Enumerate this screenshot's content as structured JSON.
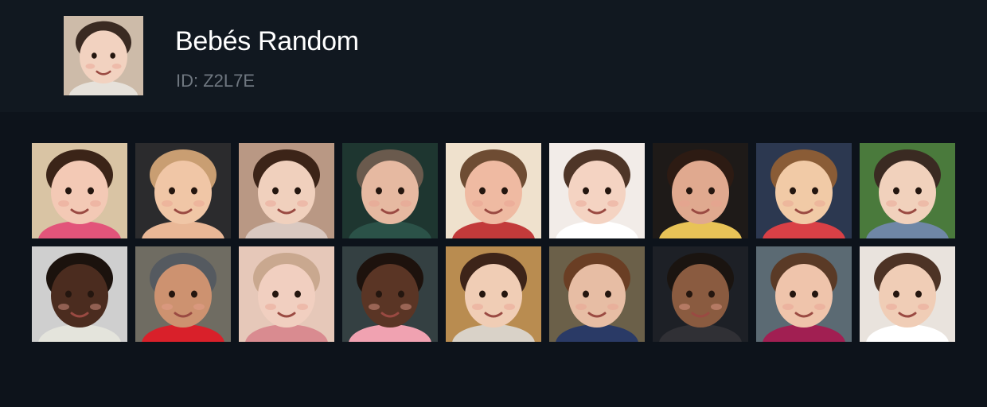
{
  "channel": {
    "name": "Bebés Random",
    "id_text": "ID: Z2L7E",
    "avatar_icon": "baby-photo",
    "avatar_colors": {
      "bg": "#cdbba9",
      "skin": "#f2d2c0",
      "hair": "#3a2a22",
      "accent": "#e6e1da"
    }
  },
  "photos": [
    {
      "icon": "baby-photo",
      "bg": "#d9c4a4",
      "skin": "#f3c9b5",
      "hair": "#3b2418",
      "accent": "#e2547a"
    },
    {
      "icon": "baby-photo",
      "bg": "#2b2b2d",
      "skin": "#f0c6a6",
      "hair": "#c99e72",
      "accent": "#e9b796"
    },
    {
      "icon": "baby-photo",
      "bg": "#b99884",
      "skin": "#f0d0bd",
      "hair": "#3c2418",
      "accent": "#d9c8c0"
    },
    {
      "icon": "baby-photo",
      "bg": "#1e3630",
      "skin": "#e6b9a1",
      "hair": "#6a5a4d",
      "accent": "#2b5248"
    },
    {
      "icon": "baby-photo",
      "bg": "#efe1cd",
      "skin": "#efbaa2",
      "hair": "#6e4c33",
      "accent": "#c23a3a"
    },
    {
      "icon": "baby-photo",
      "bg": "#f2ece8",
      "skin": "#f4d3c2",
      "hair": "#4e3527",
      "accent": "#ffffff"
    },
    {
      "icon": "baby-photo",
      "bg": "#1e1a18",
      "skin": "#e0a98f",
      "hair": "#2d1b13",
      "accent": "#e8c357"
    },
    {
      "icon": "baby-photo",
      "bg": "#2c3850",
      "skin": "#f1caa6",
      "hair": "#8a5c36",
      "accent": "#d94046"
    },
    {
      "icon": "baby-photo",
      "bg": "#4a7a3c",
      "skin": "#f1d1bc",
      "hair": "#3a2a22",
      "accent": "#6f87a6"
    },
    {
      "icon": "baby-photo",
      "bg": "#cfcfcf",
      "skin": "#4b2c1f",
      "hair": "#1b120d",
      "accent": "#e4e4dc"
    },
    {
      "icon": "baby-photo",
      "bg": "#6f6c62",
      "skin": "#cd9270",
      "hair": "#555a60",
      "accent": "#d9202a"
    },
    {
      "icon": "baby-photo",
      "bg": "#e6c8b9",
      "skin": "#f1cfc0",
      "hair": "#c9a88f",
      "accent": "#d98b90"
    },
    {
      "icon": "baby-photo",
      "bg": "#344042",
      "skin": "#5a3525",
      "hair": "#1d120d",
      "accent": "#f0a2b1"
    },
    {
      "icon": "baby-photo",
      "bg": "#b98c50",
      "skin": "#f0cdb5",
      "hair": "#3d2419",
      "accent": "#d9d2c8"
    },
    {
      "icon": "baby-photo",
      "bg": "#6b6049",
      "skin": "#e7bda4",
      "hair": "#6a3e24",
      "accent": "#2a3a66"
    },
    {
      "icon": "baby-photo",
      "bg": "#1d2026",
      "skin": "#8a5b40",
      "hair": "#1a1410",
      "accent": "#303035"
    },
    {
      "icon": "baby-photo",
      "bg": "#5b6a73",
      "skin": "#efc4ab",
      "hair": "#5a3a26",
      "accent": "#a11f52"
    },
    {
      "icon": "baby-photo",
      "bg": "#e9e3dd",
      "skin": "#f0cdb6",
      "hair": "#4d3325",
      "accent": "#ffffff"
    }
  ]
}
